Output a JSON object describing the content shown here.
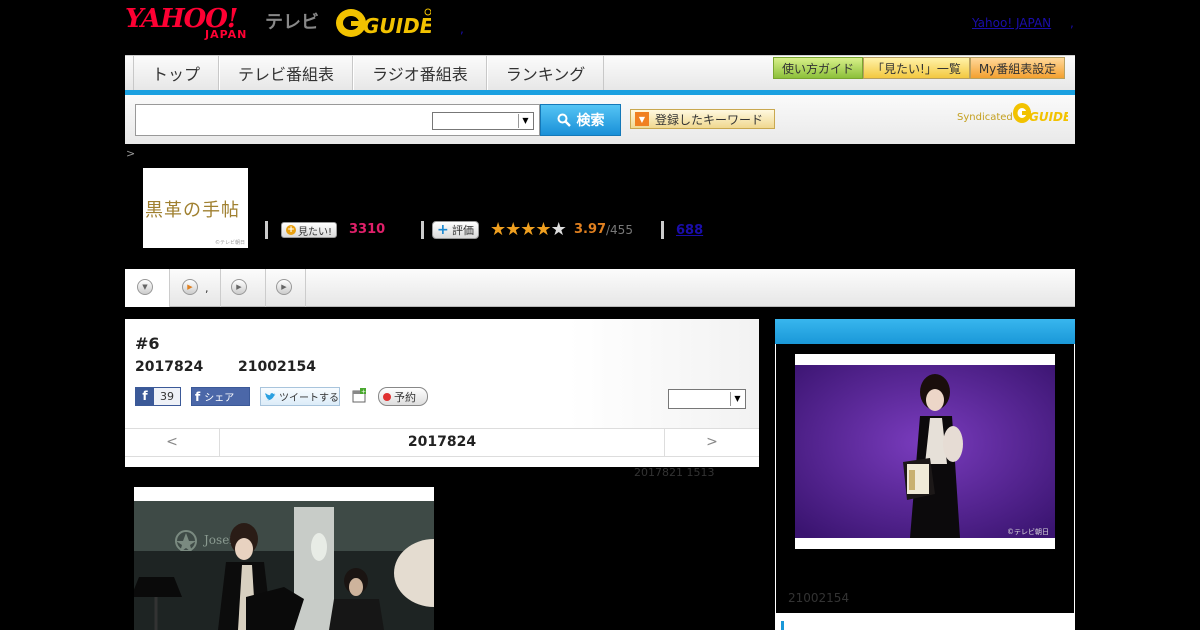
{
  "header": {
    "logo_yahoo": "YAHOO!",
    "logo_japan": "JAPAN",
    "logo_tv": "テレビ",
    "logo_gguide": "G-GUIDE",
    "dot": ",",
    "yahoo_japan_link": "Yahoo! JAPAN",
    "yahoo_japan_dot": ","
  },
  "nav": {
    "tabs": [
      {
        "label": "トップ"
      },
      {
        "label": "テレビ番組表"
      },
      {
        "label": "ラジオ番組表"
      },
      {
        "label": "ランキング"
      }
    ],
    "buttons": [
      {
        "label": "使い方ガイド"
      },
      {
        "label": "「見たい!」一覧"
      },
      {
        "label": "My番組表設定"
      }
    ]
  },
  "search": {
    "input_value": "",
    "button_label": "検索",
    "keyword_button": "登録したキーワード",
    "syndicated": "Syndicated",
    "syndicated_logo": "G-GUIDE"
  },
  "breadcrumb": ">",
  "program": {
    "thumb_title": "黒革の手帖",
    "thumb_copyright": "©テレビ朝日",
    "mitai_label": "見たい!",
    "mitai_count": "3310",
    "hyoka_label": "評価",
    "rating_stars": 3.97,
    "rating_value": "3.97",
    "rating_total": "/455",
    "review_count": "688"
  },
  "subtabs": {
    "dot": ","
  },
  "episode": {
    "title": "#6",
    "date": "2017824",
    "channel": "21002154",
    "fb_like_count": "39",
    "fb_share_label": "シェア",
    "tweet_label": "ツイートする",
    "reserve_label": "予約",
    "pager_prev": "<",
    "pager_date": "2017824",
    "pager_next": ">",
    "updated": "2017821  1513"
  },
  "sidebar": {
    "photo_copyright": "©テレビ朝日",
    "channel": "21002154"
  },
  "colors": {
    "accent_blue": "#1aa0e0",
    "mitai_pink": "#e0206a",
    "rating_orange": "#e08020",
    "yahoo_red": "#ff0033"
  }
}
